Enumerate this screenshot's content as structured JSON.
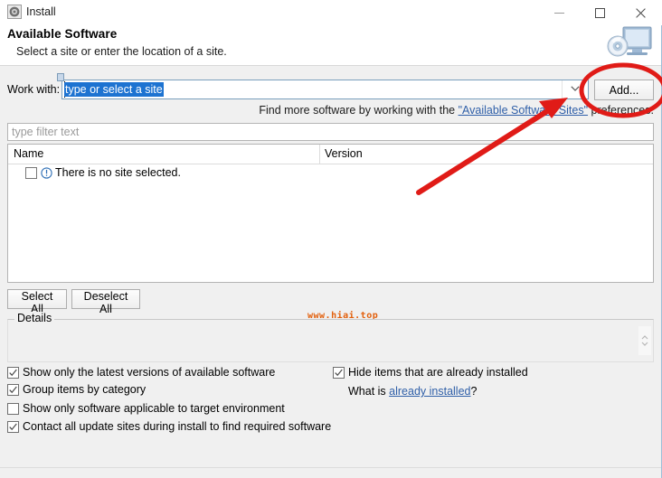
{
  "window": {
    "title": "Install",
    "icon": "install-icon",
    "controls": {
      "minimize": "minimize-icon",
      "maximize": "maximize-icon",
      "close": "close-icon"
    }
  },
  "banner": {
    "title": "Available Software",
    "subtitle": "Select a site or enter the location of a site.",
    "icon": "install-wizard-banner-icon"
  },
  "work_with": {
    "label": "Work with:",
    "value": "type or select a site",
    "placeholder": "type or select a site",
    "selected": true,
    "dropdown_icon": "chevron-down-icon",
    "add_button": "Add..."
  },
  "find_more": {
    "prefix": "Find more software by working with the ",
    "link": "\"Available Software Sites\"",
    "suffix": " preferences."
  },
  "filter": {
    "placeholder": "type filter text",
    "value": ""
  },
  "table": {
    "columns": [
      "Name",
      "Version"
    ],
    "rows": [
      {
        "checked": false,
        "icon": "info-icon",
        "name": "There is no site selected.",
        "version": ""
      }
    ]
  },
  "watermark": "www.hiai.top",
  "buttons": {
    "select_all": "Select All",
    "deselect_all": "Deselect All"
  },
  "details": {
    "legend": "Details",
    "text": "",
    "scroll_icon": "scroll-arrows-icon"
  },
  "options": [
    {
      "id": "latest",
      "label": "Show only the latest versions of available software",
      "checked": true
    },
    {
      "id": "group",
      "label": "Group items by category",
      "checked": true
    },
    {
      "id": "target",
      "label": "Show only software applicable to target environment",
      "checked": false
    },
    {
      "id": "contact",
      "label": "Contact all update sites during install to find required software",
      "checked": true
    },
    {
      "id": "hide",
      "label": "Hide items that are already installed",
      "checked": true
    }
  ],
  "what_is": {
    "prefix": "What is ",
    "link": "already installed",
    "suffix": "?"
  },
  "annotation": {
    "color": "#e01b17",
    "shapes": [
      "ellipse-around-add-button",
      "arrow-pointing-to-add-button"
    ]
  }
}
